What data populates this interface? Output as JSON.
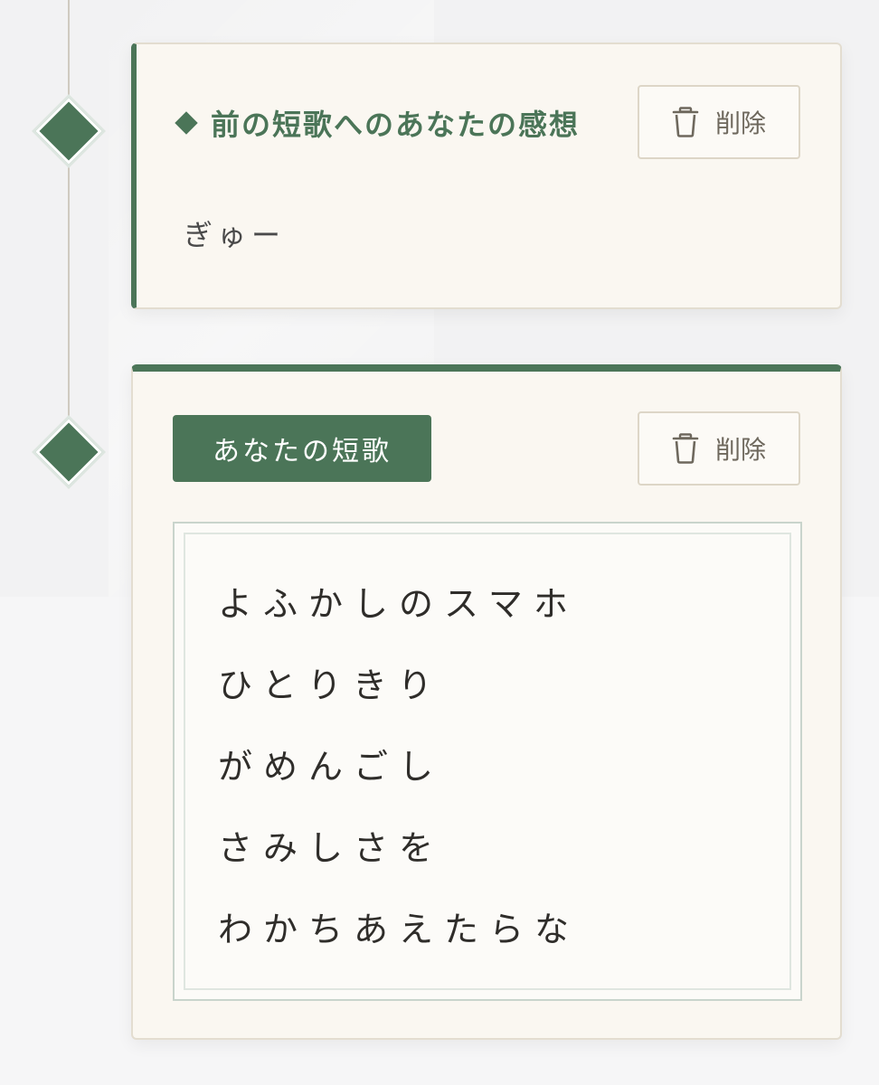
{
  "impression_card": {
    "title": "前の短歌へのあなたの感想",
    "body": "ぎゅー",
    "delete_label": "削除"
  },
  "tanka_card": {
    "label": "あなたの短歌",
    "delete_label": "削除",
    "lines": [
      "よふかしのスマホ",
      "ひとりきり",
      "がめんごし",
      "さみしさを",
      "わかちあえたらな"
    ]
  },
  "colors": {
    "accent_green": "#4b7558",
    "card_bg": "#faf7f1",
    "border": "#e3ddd0"
  },
  "icons": {
    "delete": "trash-icon",
    "title_marker": "diamond-icon",
    "timeline_node": "diamond-node-icon"
  }
}
